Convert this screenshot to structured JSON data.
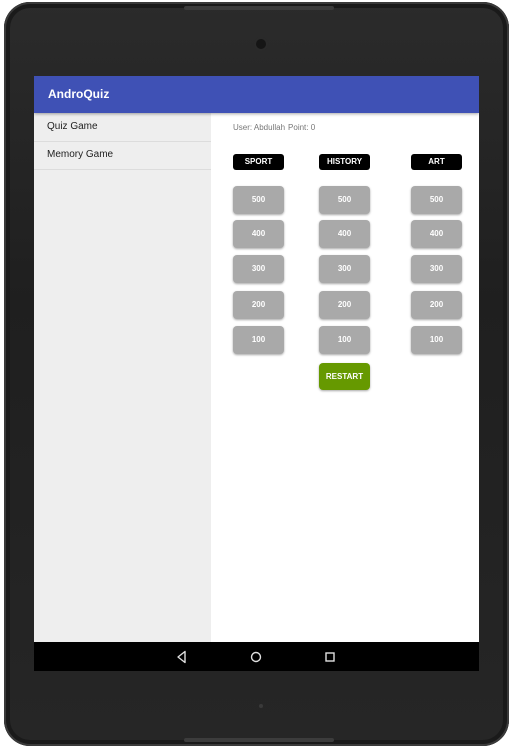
{
  "app": {
    "title": "AndroQuiz"
  },
  "sidebar": {
    "items": [
      {
        "label": "Quiz Game"
      },
      {
        "label": "Memory Game"
      }
    ]
  },
  "status": {
    "user": "User: Abdullah",
    "points": "Point: 0"
  },
  "board": {
    "categories": [
      "SPORT",
      "HISTORY",
      "ART"
    ],
    "scores": [
      "500",
      "400",
      "300",
      "200",
      "100"
    ],
    "restart_label": "RESTART"
  },
  "system_nav": {
    "icons": [
      "back-icon",
      "home-icon",
      "recents-icon"
    ]
  },
  "colors": {
    "appbar": "#3f51b5",
    "sidebar": "#eeeeee",
    "category": "#000000",
    "score_button": "#a9a9a9",
    "restart_button": "#669900"
  }
}
